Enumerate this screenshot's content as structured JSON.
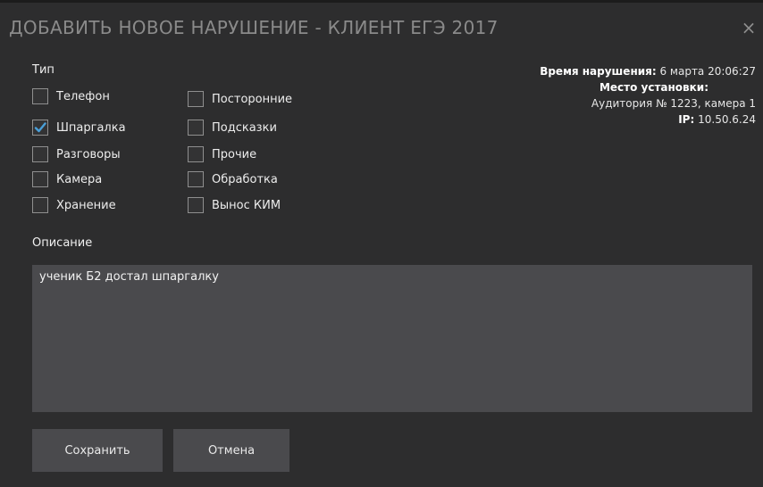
{
  "dialog": {
    "title": "ДОБАВИТЬ НОВОЕ НАРУШЕНИЕ - КЛИЕНТ ЕГЭ 2017",
    "close_glyph": "×"
  },
  "type_section": {
    "label": "Тип",
    "left_column": [
      {
        "label": "Телефон",
        "checked": false
      },
      {
        "label": "Шпаргалка",
        "checked": true
      },
      {
        "label": "Разговоры",
        "checked": false
      },
      {
        "label": "Камера",
        "checked": false
      },
      {
        "label": "Хранение",
        "checked": false
      }
    ],
    "right_column": [
      {
        "label": "Посторонние",
        "checked": false
      },
      {
        "label": "Подсказки",
        "checked": false
      },
      {
        "label": "Прочие",
        "checked": false
      },
      {
        "label": "Обработка",
        "checked": false
      },
      {
        "label": "Вынос КИМ",
        "checked": false
      }
    ]
  },
  "info": {
    "violation_time_label": "Время нарушения:",
    "violation_time_value": "6 марта 20:06:27",
    "location_label": "Место установки:",
    "location_value": "Аудитория № 1223, камера 1",
    "ip_label": "IP:",
    "ip_value": "10.50.6.24"
  },
  "description": {
    "label": "Описание",
    "value": "ученик Б2 достал шпаргалку"
  },
  "buttons": {
    "save_label": "Сохранить",
    "cancel_label": "Отмена"
  },
  "colors": {
    "checkmark": "#4a9fd8",
    "background": "#2d2d2e",
    "field": "#4a4a4d"
  }
}
